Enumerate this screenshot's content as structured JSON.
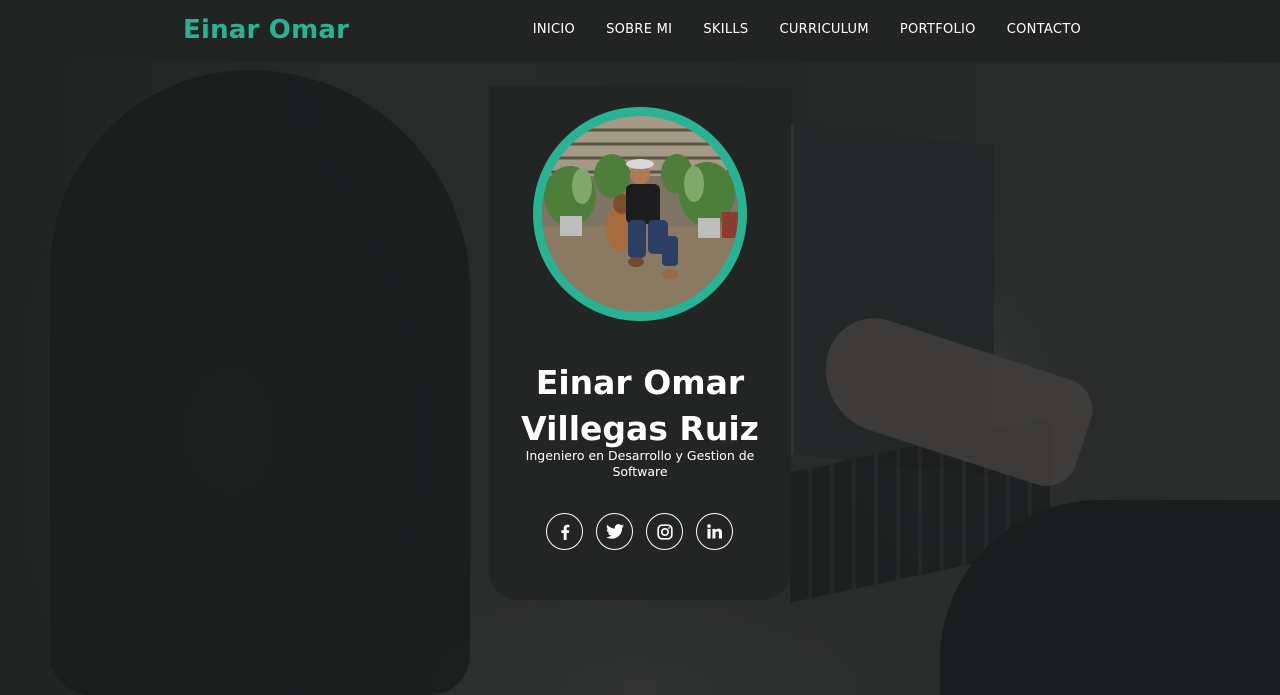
{
  "header": {
    "brand": "Einar Omar",
    "nav": [
      {
        "label": "INICIO"
      },
      {
        "label": "SOBRE MI"
      },
      {
        "label": "SKILLS"
      },
      {
        "label": "CURRICULUM"
      },
      {
        "label": "PORTFOLIO"
      },
      {
        "label": "CONTACTO"
      }
    ]
  },
  "profile": {
    "name": "Einar Omar Villegas Ruiz",
    "title": "Ingeniero en Desarrollo y Gestion de Software",
    "socials": [
      {
        "icon": "facebook-icon"
      },
      {
        "icon": "twitter-icon"
      },
      {
        "icon": "instagram-icon"
      },
      {
        "icon": "linkedin-icon"
      }
    ]
  },
  "colors": {
    "accent": "#27b394",
    "card": "#222524",
    "navbar": "#222424",
    "text": "#ffffff"
  }
}
